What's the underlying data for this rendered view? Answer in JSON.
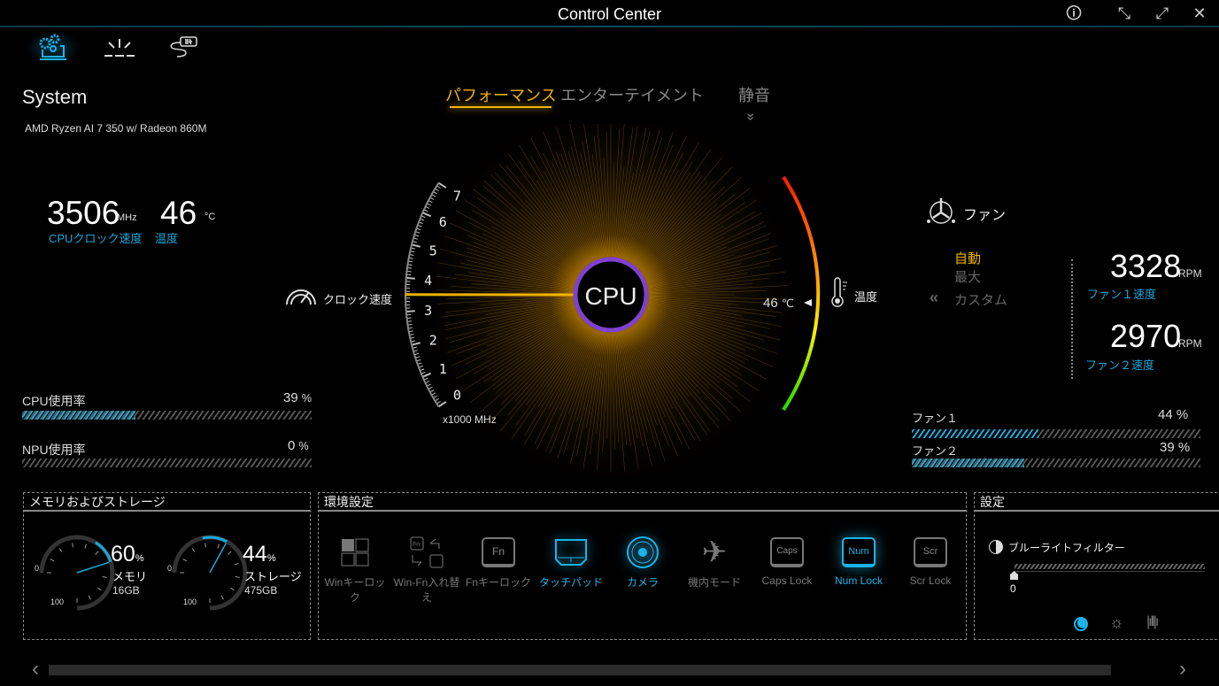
{
  "window": {
    "title": "Control Center"
  },
  "system": {
    "heading": "System",
    "cpu_name": "AMD Ryzen AI 7 350 w/ Radeon 860M",
    "clock_value": "3506",
    "clock_unit": "MHz",
    "clock_label": "CPUクロック速度",
    "temp_value": "46",
    "temp_unit": "°C",
    "temp_label": "温度",
    "cpu_usage_label": "CPU使用率",
    "cpu_usage": 39,
    "npu_usage_label": "NPU使用率",
    "npu_usage": 0,
    "pct": "%"
  },
  "modes": {
    "tabs": [
      {
        "label": "パフォーマンス",
        "active": true
      },
      {
        "label": "エンターテイメント"
      },
      {
        "label": "静音"
      }
    ]
  },
  "gauge": {
    "center_label": "CPU",
    "clock_label": "クロック速度",
    "scale_unit": "x1000 MHz",
    "ticks": [
      "0",
      "1",
      "2",
      "3",
      "4",
      "5",
      "6",
      "7"
    ],
    "clock_ghz": 3.506,
    "temp_label": "温度",
    "temp_value": "46",
    "temp_unit": "℃"
  },
  "fan": {
    "title": "ファン",
    "modes": [
      "自動",
      "最大",
      "カスタム"
    ],
    "active_mode": "自動",
    "fan1_rpm": "3328",
    "fan2_rpm": "2970",
    "rpm_unit": "RPM",
    "fan1_speed_label": "ファン１速度",
    "fan2_speed_label": "ファン２速度",
    "fan1_label": "ファン１",
    "fan1_pct": 44,
    "fan2_label": "ファン２",
    "fan2_pct": 39
  },
  "memory": {
    "title": "メモリおよびストレージ",
    "mem_pct": 60,
    "mem_label": "メモリ",
    "mem_size": "16GB",
    "sto_pct": 44,
    "sto_label": "ストレージ",
    "sto_size": "475GB",
    "scale_min": "0",
    "scale_max": "100",
    "pct_unit": "%"
  },
  "env": {
    "title": "環境設定",
    "toggles": [
      {
        "label": "Winキーロック",
        "on": false
      },
      {
        "label": "Win-Fn入れ替え",
        "on": false
      },
      {
        "label": "Fnキーロック",
        "on": false,
        "key": "Fn"
      },
      {
        "label": "タッチパッド",
        "on": true
      },
      {
        "label": "カメラ",
        "on": true
      },
      {
        "label": "機内モード",
        "on": false
      },
      {
        "label": "Caps Lock",
        "on": false,
        "key": "Caps"
      },
      {
        "label": "Num Lock",
        "on": true,
        "key": "Num"
      },
      {
        "label": "Scr Lock",
        "on": false,
        "key": "Scr"
      }
    ]
  },
  "settings": {
    "title": "設定",
    "bluelight_label": "ブルーライトフィルター",
    "bluelight_value": "0"
  },
  "colors": {
    "accent": "#1aa7d8",
    "gold": "#f0b400"
  }
}
